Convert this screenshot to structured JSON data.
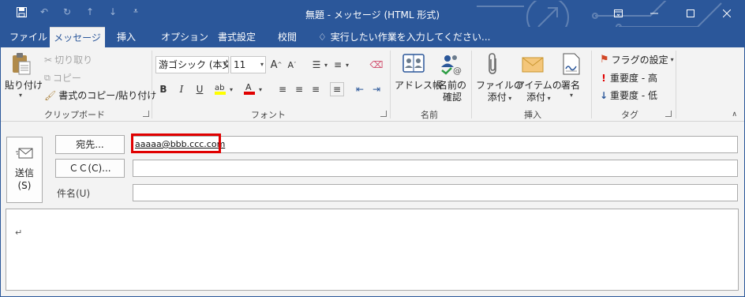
{
  "window": {
    "title": "無題 - メッセージ (HTML 形式)",
    "accent_color": "#2b579a"
  },
  "quick_access": [
    "save-icon",
    "undo-icon",
    "redo-icon",
    "up-icon",
    "down-icon",
    "customize-icon"
  ],
  "tabs": [
    {
      "label": "ファイル"
    },
    {
      "label": "メッセージ"
    },
    {
      "label": "挿入"
    },
    {
      "label": "オプション"
    },
    {
      "label": "書式設定"
    },
    {
      "label": "校閲"
    }
  ],
  "tell_me": "実行したい作業を入力してください...",
  "ribbon": {
    "clipboard": {
      "label": "クリップボード",
      "paste": "貼り付け",
      "cut": "切り取り",
      "copy": "コピー",
      "format_painter": "書式のコピー/貼り付け"
    },
    "font": {
      "label": "フォント",
      "font_name": "游ゴシック (本文",
      "font_size": "11"
    },
    "names": {
      "label": "名前",
      "address_book": "アドレス帳",
      "check_names_1": "名前の",
      "check_names_2": "確認"
    },
    "insert": {
      "label": "挿入",
      "attach_file_1": "ファイルの",
      "attach_file_2": "添付",
      "attach_item_1": "アイテムの",
      "attach_item_2": "添付",
      "signature": "署名"
    },
    "tags": {
      "label": "タグ",
      "flag": "フラグの設定",
      "high": "重要度 - 高",
      "low": "重要度 - 低"
    }
  },
  "compose": {
    "send_1": "送信",
    "send_2": "(S)",
    "to_button": "宛先...",
    "cc_button": "ＣＣ(C)...",
    "subject_label": "件名(U)",
    "to_value": "aaaaa@bbb.ccc.com",
    "cc_value": "",
    "subject_value": "",
    "body_mark": "↵"
  }
}
